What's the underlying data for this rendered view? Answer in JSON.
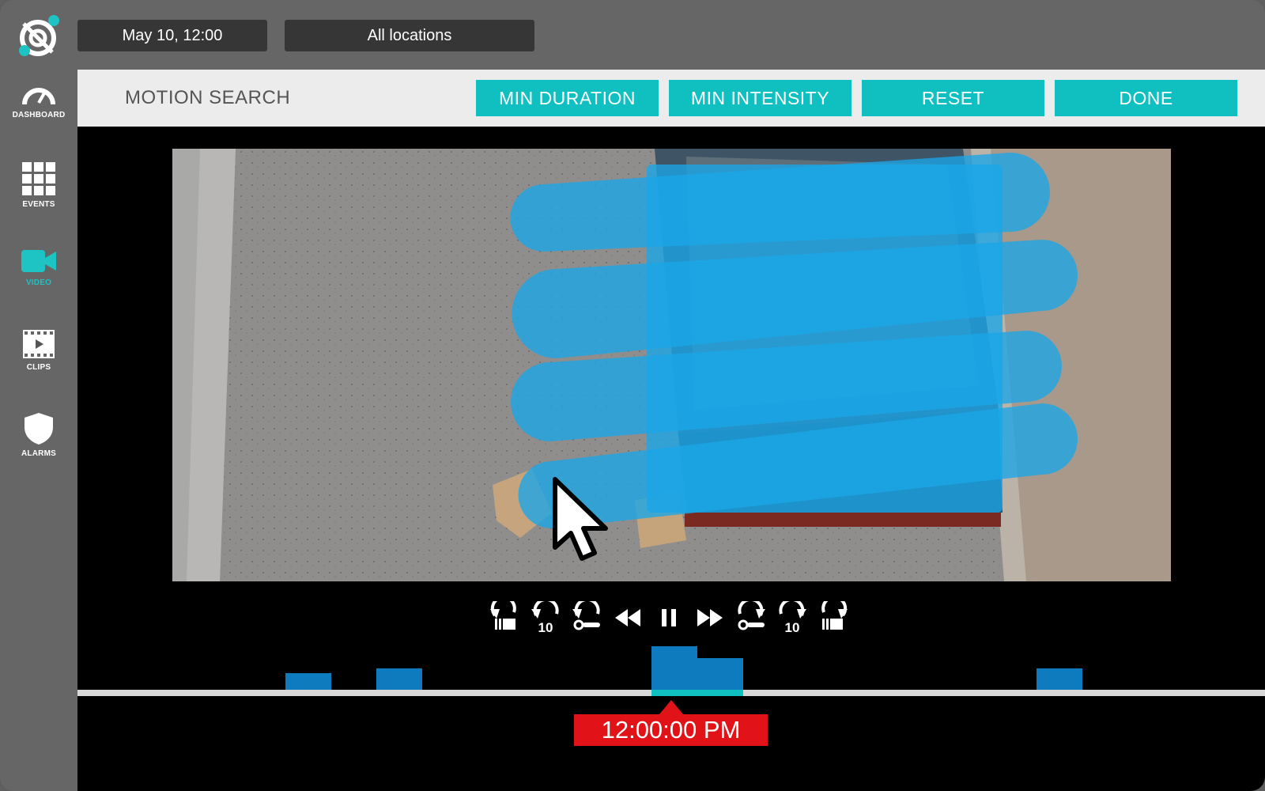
{
  "top_bar": {
    "date_value": "May 10, 12:00",
    "location_value": "All locations"
  },
  "sidebar": {
    "items": [
      {
        "label": "DASHBOARD",
        "icon": "gauge-icon",
        "active": false
      },
      {
        "label": "EVENTS",
        "icon": "grid-icon",
        "active": false
      },
      {
        "label": "VIDEO",
        "icon": "video-camera-icon",
        "active": true
      },
      {
        "label": "CLIPS",
        "icon": "clip-play-icon",
        "active": false
      },
      {
        "label": "ALARMS",
        "icon": "shield-icon",
        "active": false
      }
    ]
  },
  "header": {
    "title": "MOTION SEARCH",
    "buttons": [
      "MIN DURATION",
      "MIN INTENSITY",
      "RESET",
      "DONE"
    ]
  },
  "playback": {
    "controls": [
      "previous-event-icon",
      "rewind-10-icon",
      "previous-motion-icon",
      "rewind-icon",
      "pause-icon",
      "fast-forward-icon",
      "next-motion-icon",
      "forward-10-icon",
      "next-event-icon"
    ],
    "current_time": "12:00:00 PM"
  },
  "colors": {
    "accent": "#10c0c0",
    "motion_overlay": "#1aa7e8",
    "timeline_segment": "#0d7bbe",
    "time_marker": "#e21318"
  }
}
